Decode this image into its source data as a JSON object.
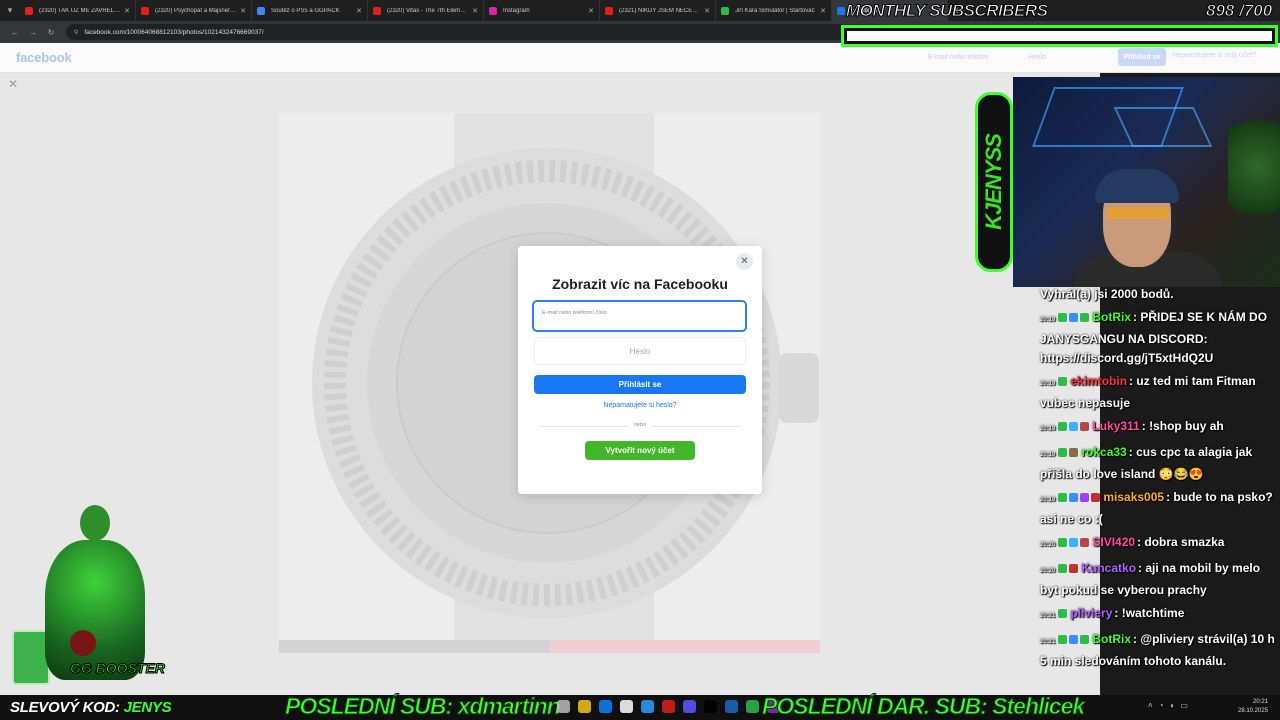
{
  "browser": {
    "tabs": [
      {
        "title": "(2320) TAK UŽ MĚ ZAVŘELI...",
        "color": "#e02020"
      },
      {
        "title": "(2320) Psychopat a Majsner v...",
        "color": "#e02020"
      },
      {
        "title": "Soutěž o PS5 a GGPACK",
        "color": "#4285f4"
      },
      {
        "title": "(2320) Vitas - The 7th Elemen...",
        "color": "#e02020"
      },
      {
        "title": "Instagram",
        "color": "#d6249f"
      },
      {
        "title": "(2321) NIKDY JSEM NEČEKAL...",
        "color": "#e02020"
      },
      {
        "title": "Jiří Kára Simulátor | Startovač",
        "color": "#2dbb4a"
      },
      {
        "title": "Facebook",
        "color": "#1877f2",
        "active": true
      }
    ],
    "new_tab": "+",
    "url": "facebook.com/100064068812103/photos/1021432476669037/"
  },
  "facebook": {
    "logo": "facebook",
    "header_email_placeholder": "E-mail nebo telefon",
    "header_password_placeholder": "Heslo",
    "header_login": "Přihlásit se",
    "header_forgot": "Nepamatujete si svůj účet?",
    "viewer_close": "✕",
    "modal": {
      "close": "✕",
      "title": "Zobrazit víc na Facebooku",
      "email_placeholder": "E-mail nebo telefonní číslo",
      "password_placeholder": "Heslo",
      "login_button": "Přihlásit se",
      "forgot_link": "Nepamatujete si heslo?",
      "separator": "nebo",
      "create_button": "Vytvořit nový účet"
    }
  },
  "overlay": {
    "subs_title": "MONTHLY SUBSCRIBERS",
    "subs_count": "898",
    "subs_goal": "/700",
    "side_logo": "KJENYSS",
    "promo_label": "SLEVOVÝ KOD: ",
    "promo_code": "JENYS",
    "last_sub": "POSLEDNÍ SUB: xdmartinn",
    "last_gift": "POSLEDNÍ DAR. SUB: Stehlicek",
    "mascot_text": "GG BOOSTER"
  },
  "chat": [
    {
      "time": "",
      "user": "",
      "user_color": "#ffffff",
      "badges": [],
      "text": "Vyhrál(a) jsi 2000 bodů."
    },
    {
      "time": "20:19",
      "user": "BotRix",
      "user_color": "#3cff2b",
      "badges": [
        "#2dbb4a",
        "#3b8dff",
        "#2dbb4a"
      ],
      "text": ": PŘIDEJ SE K NÁM DO JANYSGANGU NA DISCORD: https://discord.gg/jT5xtHdQ2U"
    },
    {
      "time": "20:19",
      "user": "ekimtobin",
      "user_color": "#ff3040",
      "badges": [
        "#2dbb4a"
      ],
      "text": ": uz ted mi tam Fitman vubec nepasuje"
    },
    {
      "time": "20:19",
      "user": "Luky311",
      "user_color": "#ff4aa0",
      "badges": [
        "#2dbb4a",
        "#3bb0ff",
        "#b84545"
      ],
      "text": ": !shop buy ah"
    },
    {
      "time": "20:19",
      "user": "rokca33",
      "user_color": "#3cff2b",
      "badges": [
        "#2dbb4a",
        "#8a6a4a"
      ],
      "text": ": cus cpc ta alagia jak přišla do love island 😳😂😍"
    },
    {
      "time": "20:19",
      "user": "misaks005",
      "user_color": "#ffb020",
      "badges": [
        "#2dbb4a",
        "#3b8dff",
        "#a040ff",
        "#c03030"
      ],
      "text": ": bude to na psko? asi ne co :("
    },
    {
      "time": "20:20",
      "user": "SIVI420",
      "user_color": "#ff4aa0",
      "badges": [
        "#2dbb4a",
        "#3bb0ff",
        "#b84545"
      ],
      "text": ": dobra smazka"
    },
    {
      "time": "20:20",
      "user": "Kuncatko",
      "user_color": "#b060ff",
      "badges": [
        "#2dbb4a",
        "#c03030"
      ],
      "text": ": aji na mobil by melo byt pokud se vyberou prachy"
    },
    {
      "time": "20:21",
      "user": "pliviery",
      "user_color": "#b060ff",
      "badges": [
        "#2dbb4a"
      ],
      "text": ": !watchtime"
    },
    {
      "time": "20:21",
      "user": "BotRix",
      "user_color": "#3cff2b",
      "badges": [
        "#2dbb4a",
        "#3b8dff",
        "#2dbb4a"
      ],
      "text": ": @pliviery strávil(a) 10 h 5 min sledováním tohoto kanálu."
    }
  ],
  "taskbar": {
    "time": "20:21",
    "date": "28.10.2025",
    "icon_colors": [
      "#bbbbbb",
      "#f5c518",
      "#0a84ff",
      "#ffffff",
      "#2aa0ff",
      "#e02020",
      "#5a5aff",
      "#000000",
      "#1b6ac9",
      "#2dbb4a",
      "#8f2dbb"
    ]
  }
}
